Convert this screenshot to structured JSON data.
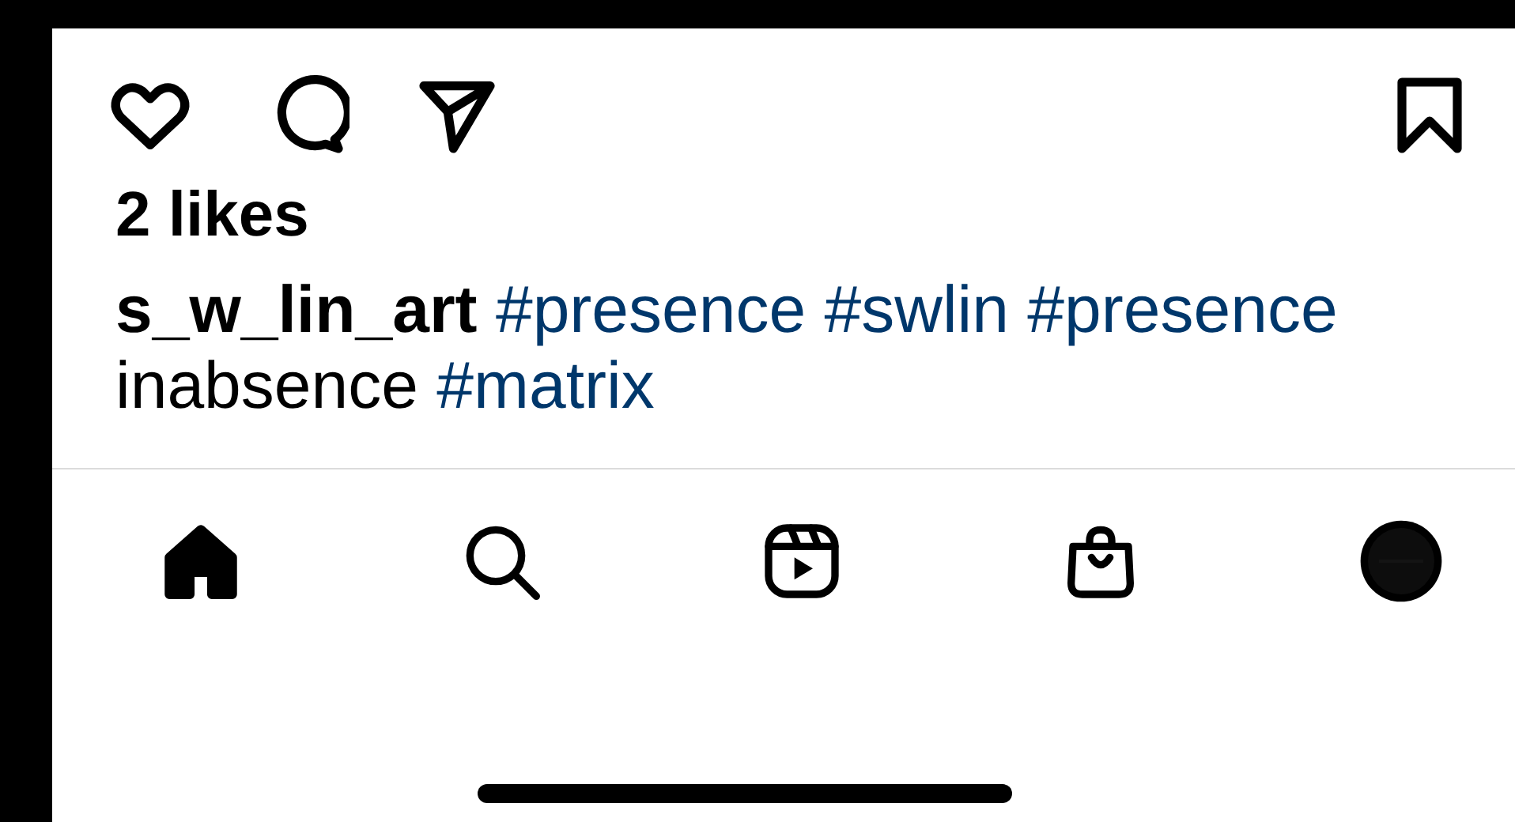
{
  "likes": "2 likes",
  "caption": [
    {
      "kind": "username",
      "text": "s_w_lin_art"
    },
    {
      "kind": "hashtag",
      "text": "#presence"
    },
    {
      "kind": "hashtag",
      "text": "#swlin"
    },
    {
      "kind": "hashtag",
      "text": "#presence"
    },
    {
      "kind": "text",
      "text": "inabsence"
    },
    {
      "kind": "hashtag",
      "text": "#matrix"
    }
  ],
  "nav": [
    {
      "kind": "home",
      "selected": true
    },
    {
      "kind": "search",
      "selected": false
    },
    {
      "kind": "reels",
      "selected": false
    },
    {
      "kind": "shop",
      "selected": false
    },
    {
      "kind": "profile",
      "selected": false
    }
  ]
}
